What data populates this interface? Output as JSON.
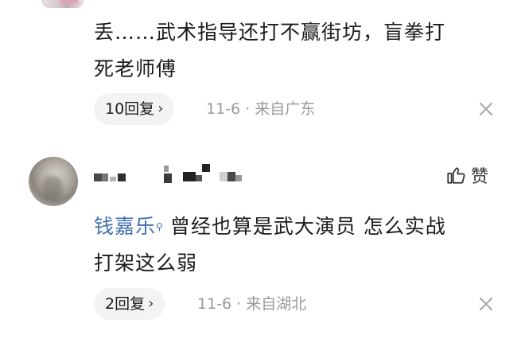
{
  "comments": [
    {
      "text": "丢……武术指导还打不赢街坊，盲拳打死老师傅",
      "line1": "丢……武术指导还打不赢街坊，盲拳打",
      "line2": "死老师傅",
      "reply_label": "10回复",
      "meta": "11-6 · 来自广东"
    },
    {
      "mention": "钱嘉乐",
      "line1_rest": "曾经也算是武大演员 怎么实战",
      "line2": "打架这么弱",
      "like_label": "赞",
      "reply_label": "2回复",
      "meta": "11-6 · 来自湖北"
    }
  ],
  "icons": {
    "reply_chevron": "chevron-right-icon",
    "close": "close-icon",
    "like": "thumbs-up-icon",
    "mention": "location-pin-icon"
  },
  "colors": {
    "mention": "#3f6fb0",
    "meta": "#9a9a9a",
    "reply_bg": "#f2f3f5"
  }
}
